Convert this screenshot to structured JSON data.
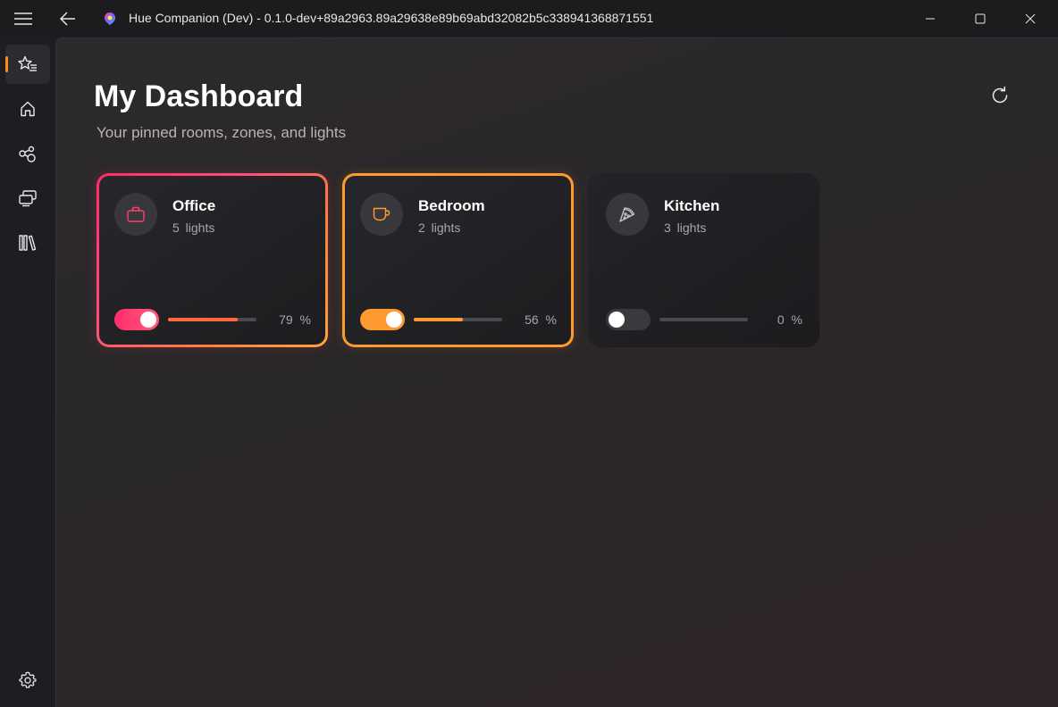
{
  "window": {
    "title": "Hue Companion (Dev) - 0.1.0-dev+89a2963.89a29638e89b69abd32082b5c338941368871551"
  },
  "nav": {
    "items": [
      {
        "icon": "favorites-icon",
        "selected": true
      },
      {
        "icon": "home-icon"
      },
      {
        "icon": "zones-icon"
      },
      {
        "icon": "devices-icon"
      },
      {
        "icon": "library-icon"
      }
    ],
    "settings_icon": "gear-icon"
  },
  "page": {
    "title": "My Dashboard",
    "subtitle": "Your pinned rooms, zones, and lights"
  },
  "cards": [
    {
      "name": "Office",
      "lights": "5 lights",
      "on": true,
      "brightness": 79,
      "pct_label": "79 %",
      "icon": "briefcase-icon",
      "accent": "#ff2d6d"
    },
    {
      "name": "Bedroom",
      "lights": "2 lights",
      "on": true,
      "brightness": 56,
      "pct_label": "56 %",
      "icon": "cup-icon",
      "accent": "#ff9a30"
    },
    {
      "name": "Kitchen",
      "lights": "3 lights",
      "on": false,
      "brightness": 0,
      "pct_label": "0 %",
      "icon": "pizza-icon",
      "accent": "#3a393d"
    }
  ],
  "colors": {
    "accent_orange": "#ff8c1a",
    "background": "#2a2729"
  }
}
